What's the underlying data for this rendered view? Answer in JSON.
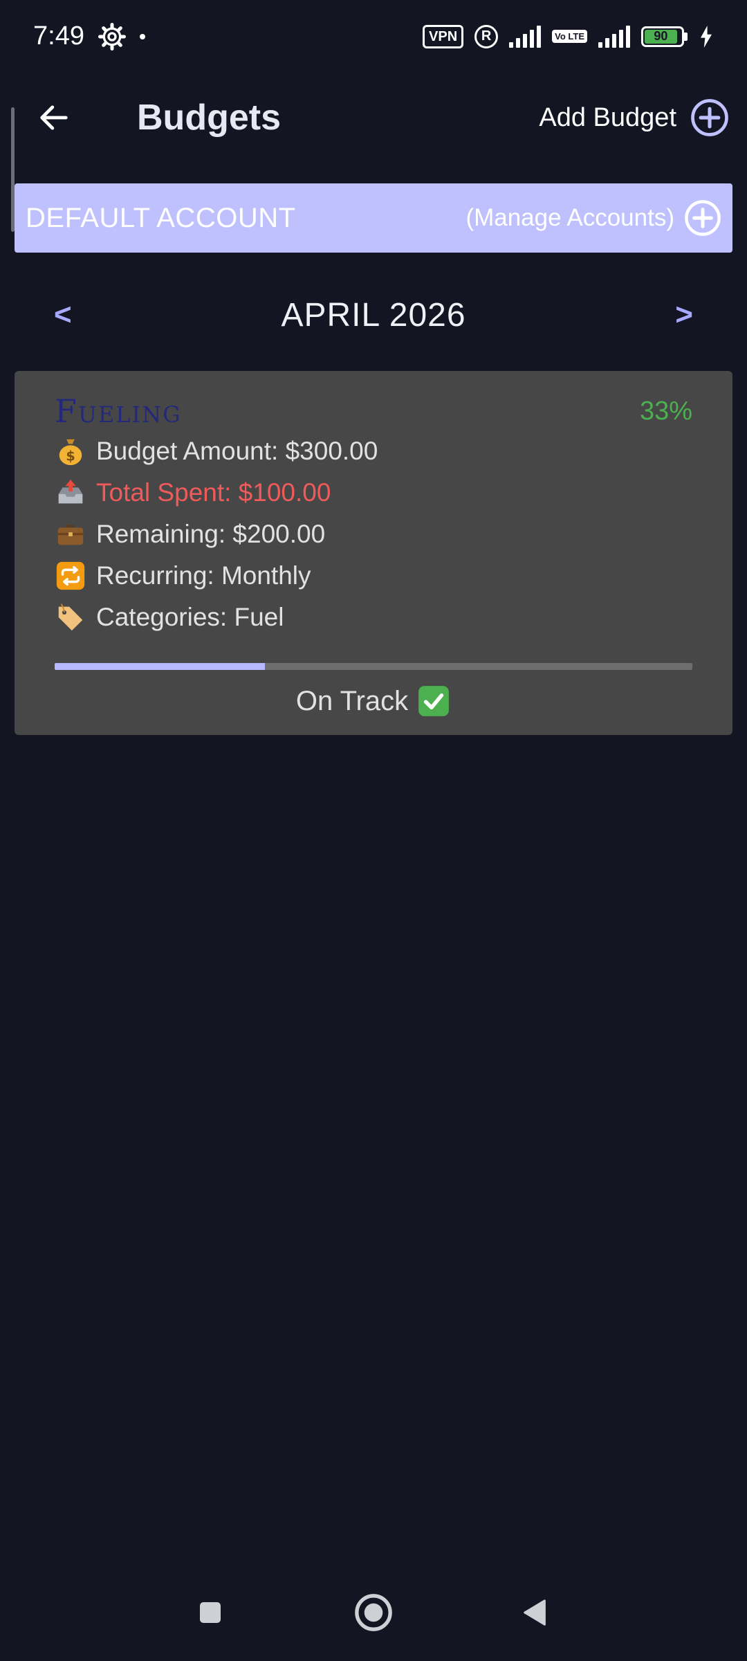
{
  "status_bar": {
    "time": "7:49",
    "vpn_label": "VPN",
    "r_label": "R",
    "volte_label": "Vo LTE",
    "battery_level": "90"
  },
  "header": {
    "title": "Budgets",
    "add_budget_label": "Add Budget"
  },
  "account": {
    "name": "DEFAULT ACCOUNT",
    "manage_label": "(Manage Accounts)"
  },
  "month_nav": {
    "prev_label": "<",
    "next_label": ">",
    "current": "APRIL 2026"
  },
  "budget": {
    "name": "Fueling",
    "percent": "33%",
    "progress_fraction": 0.33,
    "amount": "Budget Amount: $300.00",
    "spent": "Total Spent: $100.00",
    "remaining": "Remaining: $200.00",
    "recurring": "Recurring: Monthly",
    "categories": "Categories: Fuel",
    "status": "On Track"
  },
  "colors": {
    "background": "#141522",
    "accent": "#bfc1ff",
    "card": "#474747",
    "spent": "#ef5b5b",
    "percent": "#4caf50"
  },
  "icons": {
    "amount": "money-bag-icon",
    "spent": "outbox-tray-icon",
    "remaining": "briefcase-icon",
    "recurring": "repeat-icon",
    "categories": "label-tag-icon",
    "status": "check-mark-icon"
  }
}
